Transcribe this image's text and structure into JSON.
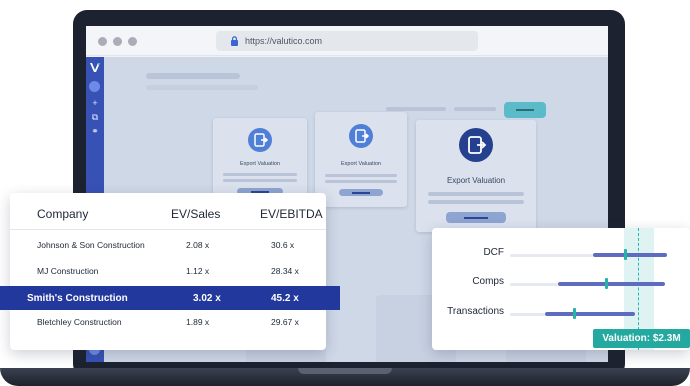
{
  "browser": {
    "url": "https://valutico.com"
  },
  "cards": [
    {
      "label": "Export Valuation"
    },
    {
      "label": "Export Valuation"
    },
    {
      "label": "Export Valuation"
    }
  ],
  "comps_table": {
    "columns": [
      "Company",
      "EV/Sales",
      "EV/EBITDA"
    ],
    "rows": [
      {
        "company": "Johnson & Son Construction",
        "ev_sales": "2.08 x",
        "ev_ebitda": "30.6 x"
      },
      {
        "company": "MJ  Construction",
        "ev_sales": "1.12 x",
        "ev_ebitda": "28.34 x"
      },
      {
        "company": "Smith's Construction",
        "ev_sales": "3.02 x",
        "ev_ebitda": "45.2 x",
        "highlighted": true
      },
      {
        "company": "Bletchley  Construction",
        "ev_sales": "1.89 x",
        "ev_ebitda": "29.67 x"
      }
    ]
  },
  "valuation": {
    "methods": [
      {
        "label": "DCF",
        "range_low": 0.52,
        "range_high": 0.98,
        "marker": 0.72
      },
      {
        "label": "Comps",
        "range_low": 0.3,
        "range_high": 0.97,
        "marker": 0.6
      },
      {
        "label": "Transactions",
        "range_low": 0.22,
        "range_high": 0.78,
        "marker": 0.4
      }
    ],
    "badge": "Valuation: $2.3M"
  },
  "colors": {
    "brand_blue": "#22389c",
    "accent_teal": "#23a99f",
    "bar": "#5d6cc0"
  }
}
